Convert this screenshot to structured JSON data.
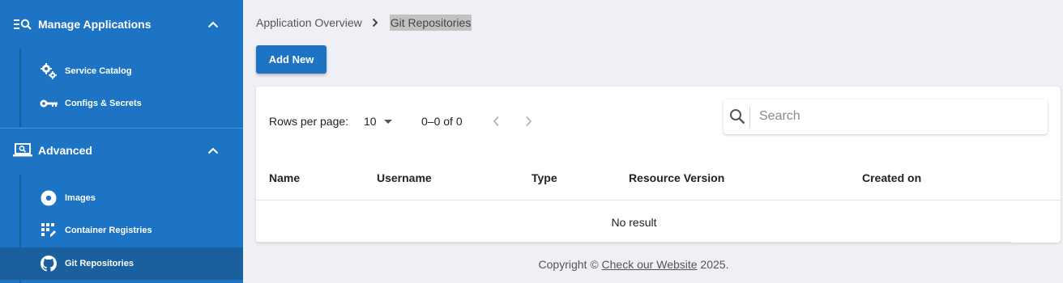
{
  "sidebar": {
    "sections": [
      {
        "label": "Manage Applications",
        "icon": "manage-search-icon",
        "items": [
          {
            "label": "Service Catalog",
            "icon": "gears-icon"
          },
          {
            "label": "Configs & Secrets",
            "icon": "key-icon"
          }
        ]
      },
      {
        "label": "Advanced",
        "icon": "laptop-search-icon",
        "items": [
          {
            "label": "Images",
            "icon": "disc-icon"
          },
          {
            "label": "Container Registries",
            "icon": "registry-grid-icon"
          },
          {
            "label": "Git Repositories",
            "icon": "github-icon",
            "active": true
          }
        ]
      }
    ],
    "colors": {
      "background": "#1e74c4",
      "active": "#1a5f9e"
    }
  },
  "breadcrumb": {
    "items": [
      "Application Overview",
      "Git Repositories"
    ]
  },
  "toolbar": {
    "add_label": "Add New"
  },
  "table": {
    "rows_per_page_label": "Rows per page:",
    "rows_per_page_value": "10",
    "range_text": "0–0 of 0",
    "search_placeholder": "Search",
    "columns": [
      "Name",
      "Username",
      "Type",
      "Resource Version",
      "Created on"
    ],
    "empty_text": "No result"
  },
  "footer": {
    "prefix": "Copyright © ",
    "link": "Check our Website",
    "suffix": " 2025."
  }
}
